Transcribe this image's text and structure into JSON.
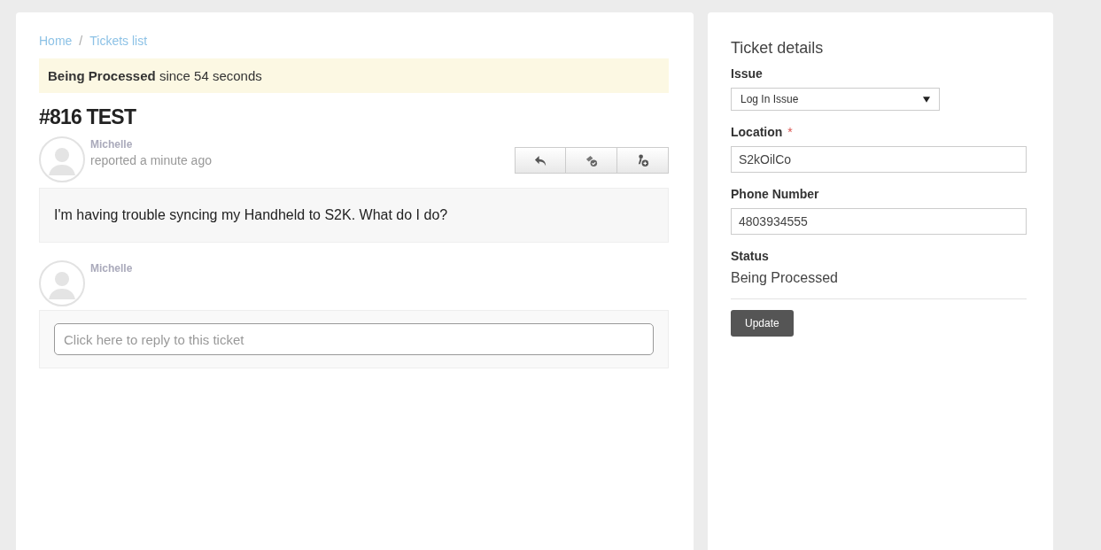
{
  "breadcrumb": [
    {
      "label": "Home"
    },
    {
      "separator": "/",
      "label": "Tickets list"
    }
  ],
  "status_banner": {
    "state": "Being Processed",
    "text": "since 54 seconds"
  },
  "ticket": {
    "title": "#816 TEST",
    "author": "Michelle",
    "meta": "reported a minute ago",
    "message": "I'm having trouble syncing my Handheld to S2K. What do I do?"
  },
  "reply": {
    "author": "Michelle",
    "placeholder": "Click here to reply to this ticket"
  },
  "details": {
    "title": "Ticket details",
    "fields": [
      {
        "kind": "select",
        "label": "Issue",
        "value": "Log In Issue"
      },
      {
        "kind": "input",
        "label": "Location",
        "value": "S2kOilCo",
        "required_mark": "*"
      },
      {
        "kind": "input",
        "label": "Phone Number",
        "value": "4803934555"
      },
      {
        "kind": "text",
        "label": "Status",
        "value": "Being Processed"
      }
    ],
    "button": "Update"
  }
}
